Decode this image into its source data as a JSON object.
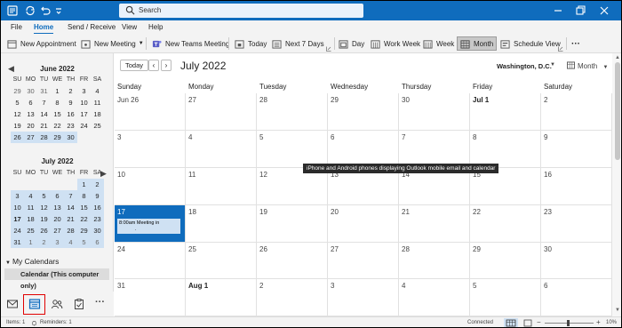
{
  "titlebar": {
    "search_placeholder": "Search",
    "icons": [
      "outlook-logo-icon",
      "sync-icon",
      "undo-icon",
      "qat-dropdown-icon",
      "search-icon",
      "minimize-icon",
      "restore-icon",
      "close-icon"
    ]
  },
  "menubar": {
    "items": [
      "File",
      "Home",
      "Send / Receive",
      "View",
      "Help"
    ]
  },
  "ribbon": {
    "new_appointment": "New Appointment",
    "new_meeting": "New Meeting",
    "new_teams_meeting": "New Teams Meeting",
    "today": "Today",
    "next_7_days": "Next 7 Days",
    "day": "Day",
    "work_week": "Work Week",
    "week": "Week",
    "month": "Month",
    "schedule_view": "Schedule View",
    "more": "···"
  },
  "sidebar": {
    "june": {
      "title": "June 2022",
      "dow": [
        "SU",
        "MO",
        "TU",
        "WE",
        "TH",
        "FR",
        "SA"
      ],
      "weeks": [
        [
          "29",
          "30",
          "31",
          "1",
          "2",
          "3",
          "4"
        ],
        [
          "5",
          "6",
          "7",
          "8",
          "9",
          "10",
          "11"
        ],
        [
          "12",
          "13",
          "14",
          "15",
          "16",
          "17",
          "18"
        ],
        [
          "19",
          "20",
          "21",
          "22",
          "23",
          "24",
          "25"
        ],
        [
          "26",
          "27",
          "28",
          "29",
          "30",
          "",
          ""
        ]
      ]
    },
    "july": {
      "title": "July 2022",
      "dow": [
        "SU",
        "MO",
        "TU",
        "WE",
        "TH",
        "FR",
        "SA"
      ],
      "weeks": [
        [
          "",
          "",
          "",
          "",
          "",
          "1",
          "2"
        ],
        [
          "3",
          "4",
          "5",
          "6",
          "7",
          "8",
          "9"
        ],
        [
          "10",
          "11",
          "12",
          "13",
          "14",
          "15",
          "16"
        ],
        [
          "17",
          "18",
          "19",
          "20",
          "21",
          "22",
          "23"
        ],
        [
          "24",
          "25",
          "26",
          "27",
          "28",
          "29",
          "30"
        ],
        [
          "31",
          "1",
          "2",
          "3",
          "4",
          "5",
          "6"
        ]
      ]
    },
    "my_calendars": "My Calendars",
    "calendar_item": "Calendar (This computer only)"
  },
  "main": {
    "today_btn": "Today",
    "prev": "‹",
    "next": "›",
    "month_title": "July 2022",
    "location": "Washington, D.C.",
    "view": "Month",
    "dow": [
      "Sunday",
      "Monday",
      "Tuesday",
      "Wednesday",
      "Thursday",
      "Friday",
      "Saturday"
    ],
    "weeks": [
      [
        "Jun 26",
        "27",
        "28",
        "29",
        "30",
        "Jul 1",
        "2"
      ],
      [
        "3",
        "4",
        "5",
        "6",
        "7",
        "8",
        "9"
      ],
      [
        "10",
        "11",
        "12",
        "13",
        "14",
        "15",
        "16"
      ],
      [
        "17",
        "18",
        "19",
        "20",
        "21",
        "22",
        "23"
      ],
      [
        "24",
        "25",
        "26",
        "27",
        "28",
        "29",
        "30"
      ],
      [
        "31",
        "Aug 1",
        "2",
        "3",
        "4",
        "5",
        "6"
      ]
    ],
    "event_title": "8:00am Meeting in",
    "event_sub": ".",
    "tooltip": "iPhone and Android phones displaying Outlook mobile email and calendar"
  },
  "statusbar": {
    "items": "Items: 1",
    "reminders": "Reminders: 1",
    "connected": "Connected",
    "zoom": "10%"
  },
  "colors": {
    "accent": "#0f6cbd",
    "highlight": "#cfe1f3",
    "red_box": "#e00000"
  }
}
